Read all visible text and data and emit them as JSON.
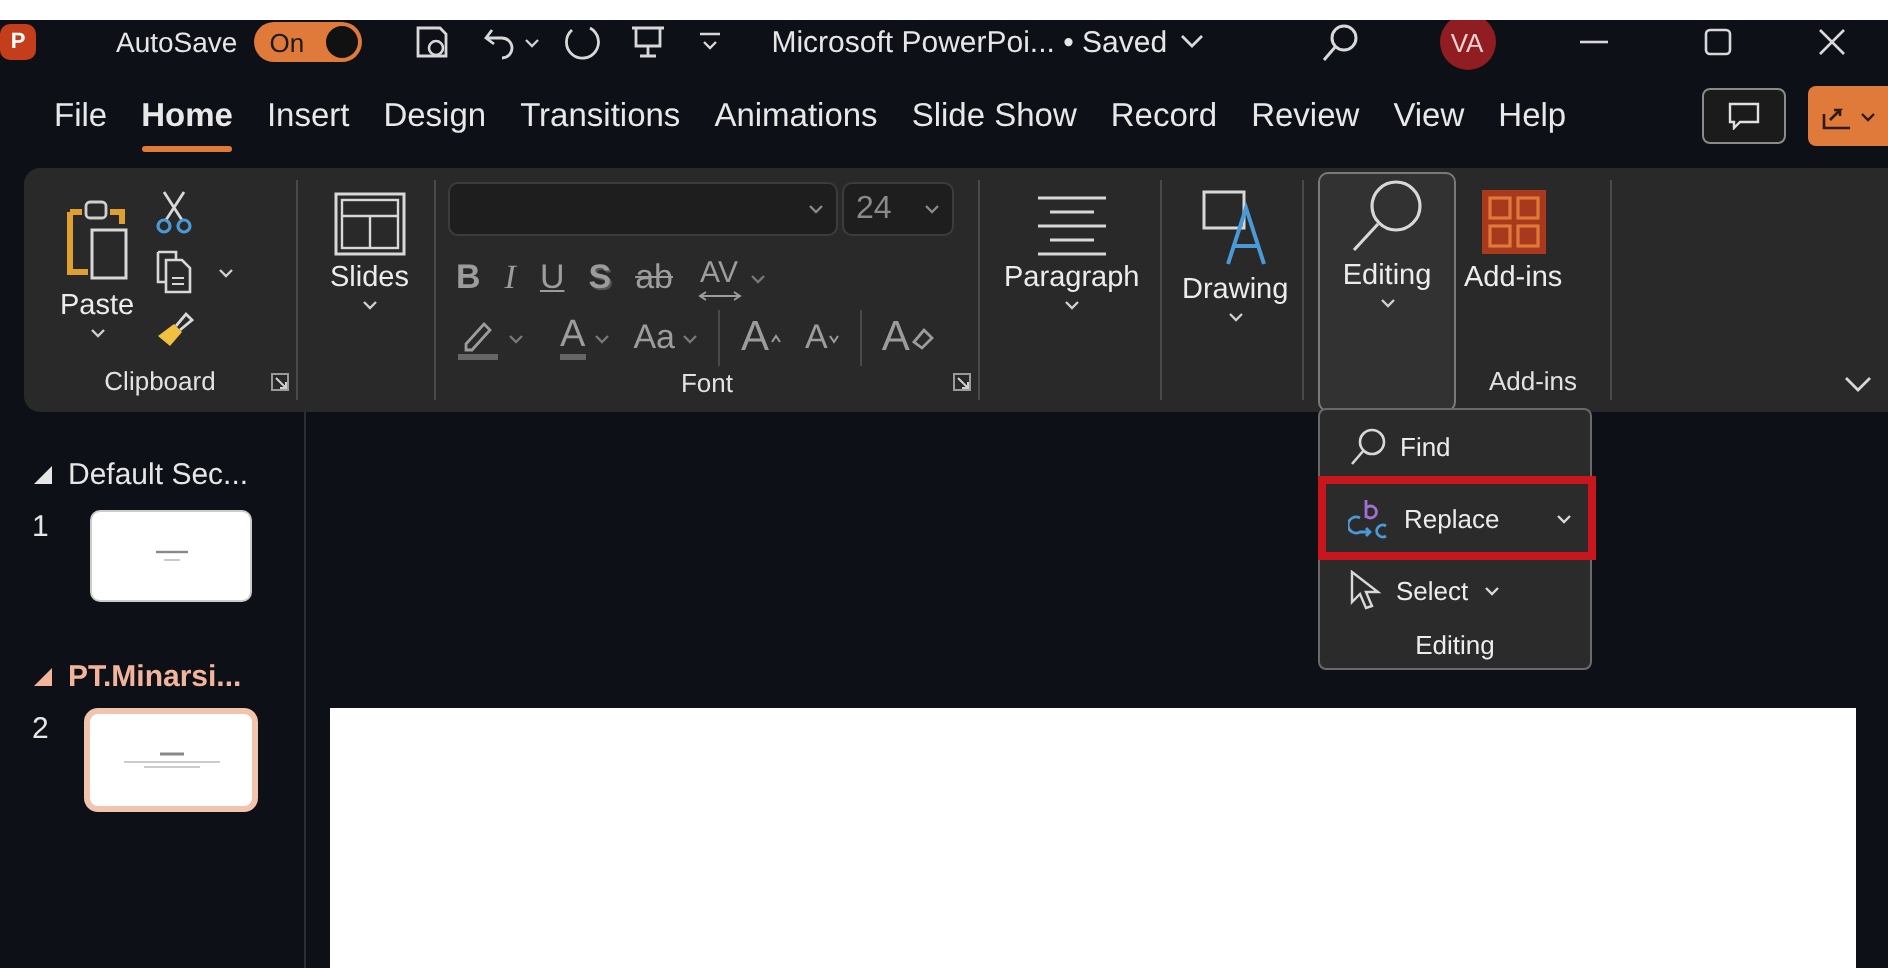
{
  "titlebar": {
    "app_letter": "P",
    "autosave": {
      "label": "AutoSave",
      "state_text": "On",
      "on": true
    },
    "document_title": "Microsoft PowerPoi... • Saved",
    "avatar": "VA"
  },
  "tabs": [
    {
      "label": "File",
      "selected": false
    },
    {
      "label": "Home",
      "selected": true
    },
    {
      "label": "Insert",
      "selected": false
    },
    {
      "label": "Design",
      "selected": false
    },
    {
      "label": "Transitions",
      "selected": false
    },
    {
      "label": "Animations",
      "selected": false
    },
    {
      "label": "Slide Show",
      "selected": false
    },
    {
      "label": "Record",
      "selected": false
    },
    {
      "label": "Review",
      "selected": false
    },
    {
      "label": "View",
      "selected": false
    },
    {
      "label": "Help",
      "selected": false
    }
  ],
  "ribbon": {
    "clipboard": {
      "paste": "Paste",
      "label": "Clipboard"
    },
    "slides": {
      "button": "Slides"
    },
    "font": {
      "font_size": "24",
      "label": "Font",
      "row_1": [
        {
          "text": "B",
          "kind": "bold"
        },
        {
          "text": "I",
          "kind": "italic"
        },
        {
          "text": "U",
          "kind": "underline"
        },
        {
          "text": "S",
          "kind": "shadow"
        },
        {
          "text": "ab",
          "kind": "strike"
        },
        {
          "text": "AV",
          "kind": "spacing"
        }
      ],
      "row_2": [
        {
          "kind": "highlight"
        },
        {
          "text": "A",
          "kind": "color"
        },
        {
          "text": "Aa",
          "kind": "case"
        },
        {
          "text": "A",
          "kind": "grow"
        },
        {
          "text": "A",
          "kind": "shrink"
        },
        {
          "text": "A",
          "kind": "clear"
        }
      ]
    },
    "paragraph": {
      "button": "Paragraph"
    },
    "drawing": {
      "button": "Drawing"
    },
    "editing": {
      "button": "Editing",
      "expanded": true
    },
    "addins": {
      "button": "Add-ins",
      "label": "Add-ins"
    }
  },
  "editing_menu": {
    "items": [
      {
        "label": "Find",
        "kind": "find",
        "has_submenu": false,
        "highlighted": false
      },
      {
        "label": "Replace",
        "kind": "replace",
        "has_submenu": true,
        "highlighted": true
      },
      {
        "label": "Select",
        "kind": "select",
        "has_submenu": true,
        "highlighted": false
      }
    ],
    "group_label": "Editing"
  },
  "slide_pane": {
    "sections": [
      {
        "title": "Default Sec...",
        "selected": false,
        "slides": [
          {
            "number": "1",
            "selected": false
          }
        ]
      },
      {
        "title": "PT.Minarsi...",
        "selected": true,
        "slides": [
          {
            "number": "2",
            "selected": true
          }
        ]
      }
    ]
  }
}
